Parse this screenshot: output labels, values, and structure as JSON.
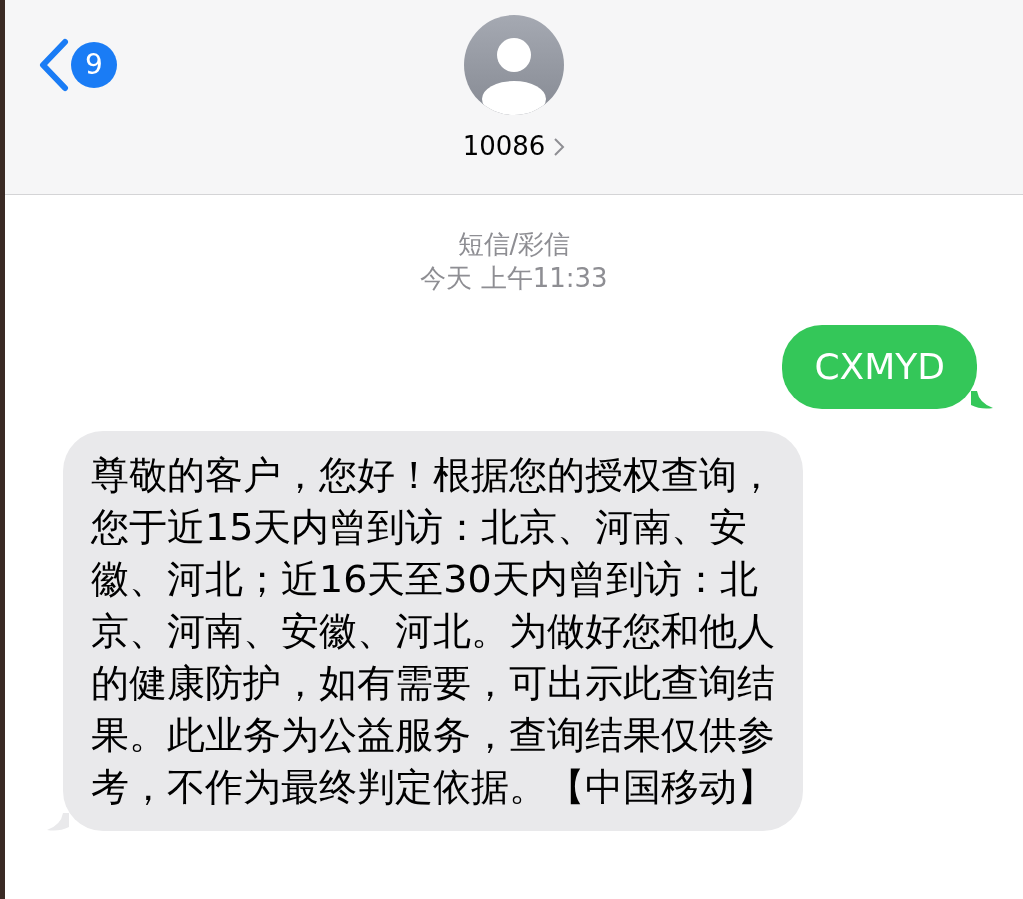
{
  "header": {
    "back_badge": "9",
    "contact": "10086"
  },
  "conversation": {
    "service": "短信/彩信",
    "timestamp": "今天 上午11:33"
  },
  "messages": [
    {
      "kind": "sent",
      "text": "CXMYD"
    },
    {
      "kind": "received",
      "text": "尊敬的客户，您好！根据您的授权查询，您于近15天内曾到访：北京、河南、安徽、河北；近16天至30天内曾到访：北京、河南、安徽、河北。为做好您和他人的健康防护，如有需要，可出示此查询结果。此业务为公益服务，查询结果仅供参考，不作为最终判定依据。【中国移动】"
    }
  ]
}
